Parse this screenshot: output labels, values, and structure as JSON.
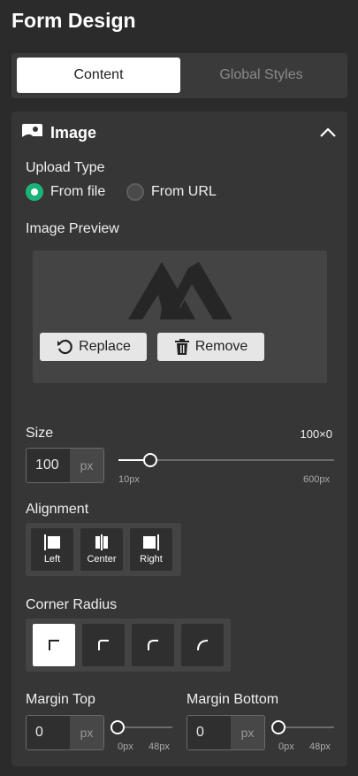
{
  "header": {
    "title": "Form Design"
  },
  "tabs": [
    {
      "label": "Content",
      "active": true
    },
    {
      "label": "Global Styles",
      "active": false
    }
  ],
  "section": {
    "title": "Image",
    "icon": "image-icon",
    "collapse_icon": "chevron-up-icon"
  },
  "upload": {
    "label": "Upload Type",
    "options": [
      {
        "label": "From file",
        "selected": true
      },
      {
        "label": "From URL",
        "selected": false
      }
    ]
  },
  "preview": {
    "label": "Image Preview",
    "replace_label": "Replace",
    "remove_label": "Remove"
  },
  "size": {
    "label": "Size",
    "dimensions": "100×0",
    "value": "100",
    "unit": "px",
    "min_label": "10px",
    "max_label": "600px",
    "min": 10,
    "max": 600,
    "current": 100
  },
  "alignment": {
    "label": "Alignment",
    "options": [
      {
        "label": "Left",
        "icon": "align-left-icon"
      },
      {
        "label": "Center",
        "icon": "align-center-icon"
      },
      {
        "label": "Right",
        "icon": "align-right-icon"
      }
    ]
  },
  "corner_radius": {
    "label": "Corner Radius",
    "options": [
      "radius-none-icon",
      "radius-small-icon",
      "radius-medium-icon",
      "radius-large-icon"
    ],
    "selected_index": 0
  },
  "margin_top": {
    "label": "Margin Top",
    "value": "0",
    "unit": "px",
    "min_label": "0px",
    "max_label": "48px",
    "current": 0
  },
  "margin_bottom": {
    "label": "Margin Bottom",
    "value": "0",
    "unit": "px",
    "min_label": "0px",
    "max_label": "48px",
    "current": 0
  },
  "colors": {
    "accent": "#1db27a",
    "background": "#2b2b2b",
    "panel": "#363636"
  }
}
